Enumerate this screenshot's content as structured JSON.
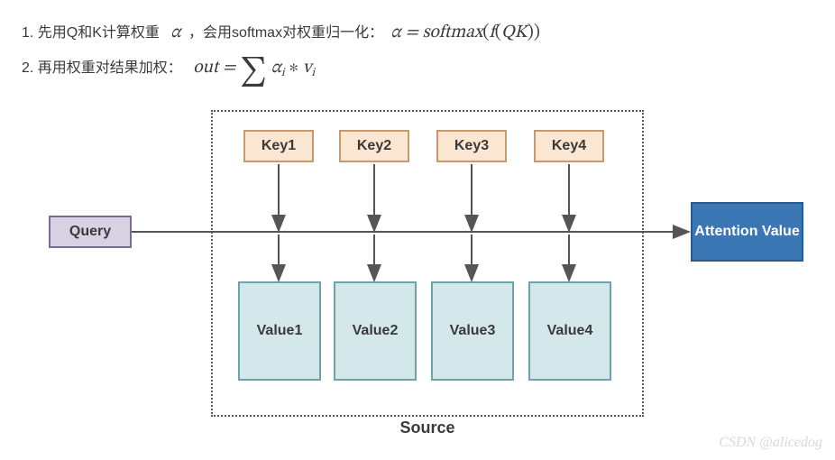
{
  "lines": {
    "item1_prefix": "1. 先用Q和K计算权重 ",
    "alpha": "α",
    "item1_mid": " ，会用softmax对权重归一化：",
    "eq1_lhs": "α = ",
    "eq1_fn": "softmax",
    "eq1_open": "(",
    "eq1_inner_fn": "f",
    "eq1_inner_open": "(",
    "eq1_inner_arg": "QK",
    "eq1_inner_close": ")",
    "eq1_close": ")",
    "item2_prefix": "2. 再用权重对结果加权：",
    "eq2_lhs": "out = ",
    "sigma": "∑",
    "eq2_alpha": "α",
    "sub_i1": "i",
    "eq2_star": " ∗ ",
    "eq2_v": "v",
    "sub_i2": "i"
  },
  "diagram": {
    "query": "Query",
    "attention": "Attention Value",
    "keys": [
      "Key1",
      "Key2",
      "Key3",
      "Key4"
    ],
    "values": [
      "Value1",
      "Value2",
      "Value3",
      "Value4"
    ],
    "source": "Source"
  },
  "watermark": "CSDN @alicedog"
}
